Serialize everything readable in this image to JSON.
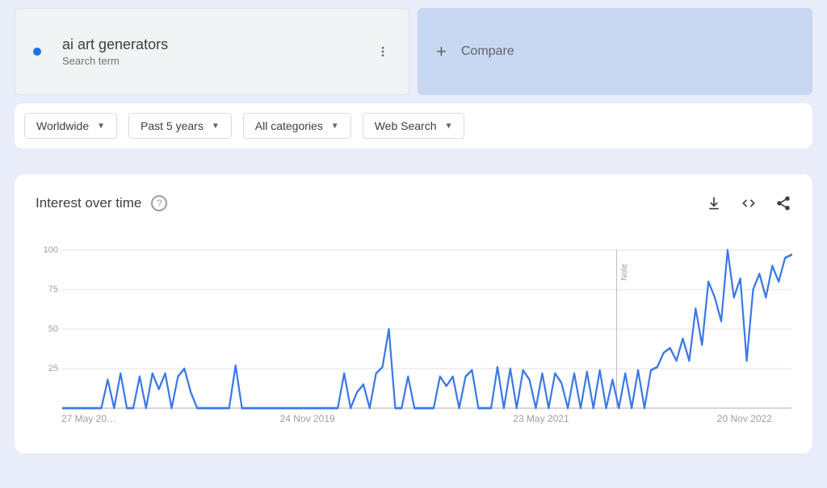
{
  "search_term": {
    "dot_color": "#1a73e8",
    "title": "ai art generators",
    "subtitle": "Search term"
  },
  "compare_label": "Compare",
  "filters": {
    "geo": "Worldwide",
    "time": "Past 5 years",
    "category": "All categories",
    "property": "Web Search"
  },
  "chart": {
    "title": "Interest over time",
    "note_label": "Note"
  },
  "chart_data": {
    "type": "line",
    "title": "Interest over time",
    "xlabel": "",
    "ylabel": "",
    "ylim": [
      0,
      100
    ],
    "yticks": [
      25,
      50,
      75,
      100
    ],
    "x_tick_labels": [
      "27 May 20…",
      "24 Nov 2019",
      "23 May 2021",
      "20 Nov 2022"
    ],
    "x_tick_positions_pct": [
      0,
      30,
      62,
      90
    ],
    "note_marker_x_pct": 76,
    "series_color": "#3b78e7",
    "n_points": 110,
    "values": [
      0,
      0,
      0,
      0,
      0,
      0,
      0,
      18,
      0,
      22,
      0,
      0,
      20,
      0,
      22,
      12,
      22,
      0,
      20,
      25,
      10,
      0,
      0,
      0,
      0,
      0,
      0,
      27,
      0,
      0,
      0,
      0,
      0,
      0,
      0,
      0,
      0,
      0,
      0,
      0,
      0,
      0,
      0,
      0,
      22,
      0,
      10,
      15,
      0,
      22,
      26,
      50,
      0,
      0,
      20,
      0,
      0,
      0,
      0,
      20,
      14,
      20,
      0,
      20,
      24,
      0,
      0,
      0,
      26,
      0,
      25,
      0,
      24,
      18,
      0,
      22,
      0,
      22,
      16,
      0,
      22,
      0,
      23,
      0,
      24,
      0,
      18,
      0,
      22,
      0,
      24,
      0,
      24,
      26,
      35,
      38,
      30,
      44,
      30,
      63,
      40,
      80,
      70,
      55,
      100,
      70,
      82,
      30,
      75,
      85,
      70,
      90,
      80,
      95,
      97
    ]
  }
}
